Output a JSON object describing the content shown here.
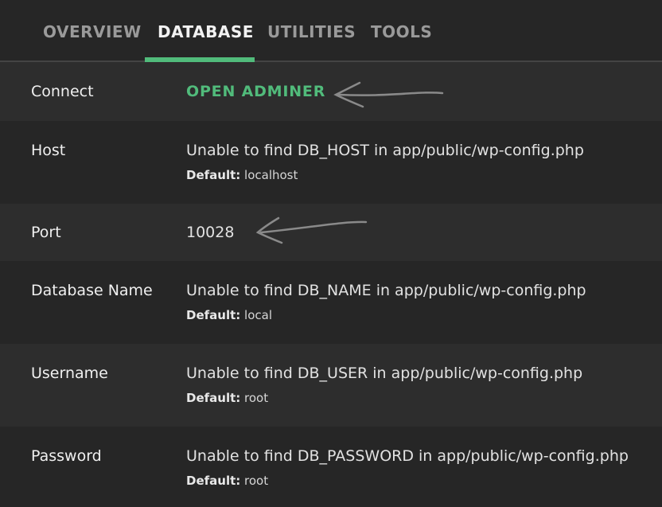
{
  "tabs": [
    {
      "label": "OVERVIEW",
      "active": false
    },
    {
      "label": "DATABASE",
      "active": true
    },
    {
      "label": "UTILITIES",
      "active": false
    },
    {
      "label": "TOOLS",
      "active": false
    }
  ],
  "accent_color": "#51bb7b",
  "rows": {
    "connect": {
      "label": "Connect",
      "link": "OPEN ADMINER"
    },
    "host": {
      "label": "Host",
      "value": "Unable to find DB_HOST in app/public/wp-config.php",
      "default_label": "Default:",
      "default_value": "localhost"
    },
    "port": {
      "label": "Port",
      "value": "10028"
    },
    "dbname": {
      "label": "Database Name",
      "value": "Unable to find DB_NAME in app/public/wp-config.php",
      "default_label": "Default:",
      "default_value": "local"
    },
    "username": {
      "label": "Username",
      "value": "Unable to find DB_USER in app/public/wp-config.php",
      "default_label": "Default:",
      "default_value": "root"
    },
    "password": {
      "label": "Password",
      "value": "Unable to find DB_PASSWORD in app/public/wp-config.php",
      "default_label": "Default:",
      "default_value": "root"
    }
  }
}
